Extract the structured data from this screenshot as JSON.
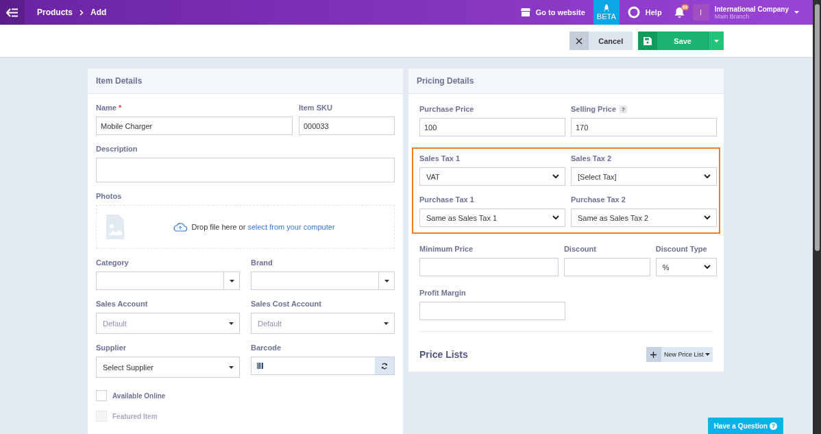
{
  "topbar": {
    "breadcrumb": [
      "Products",
      "Add"
    ],
    "go_to_website": "Go to website",
    "beta": "BETA",
    "help": "Help",
    "notifications": "69",
    "account": {
      "initial": "I",
      "name": "International Company",
      "branch": "Main Branch"
    }
  },
  "actions": {
    "cancel": "Cancel",
    "save": "Save"
  },
  "item_details": {
    "title": "Item Details",
    "rows": [
      [
        {
          "kind": "text",
          "label": "Name",
          "required_mark": "*",
          "value": "Mobile Charger"
        },
        {
          "kind": "text",
          "label": "Item SKU",
          "value": "000033"
        }
      ],
      [
        {
          "kind": "textarea",
          "label": "Description"
        }
      ],
      [
        {
          "kind": "photos",
          "label": "Photos",
          "text": "Drop file here or",
          "link": "select from your computer"
        }
      ],
      [
        {
          "kind": "combo",
          "label": "Category"
        },
        {
          "kind": "combo",
          "label": "Brand"
        }
      ],
      [
        {
          "kind": "select",
          "label": "Sales Account",
          "value": "Default",
          "muted": true
        },
        {
          "kind": "select",
          "label": "Sales Cost Account",
          "value": "Default",
          "muted": true
        }
      ],
      [
        {
          "kind": "select",
          "label": "Supplier",
          "value": "Select Supplier",
          "muted": false
        },
        {
          "kind": "barcode",
          "label": "Barcode"
        }
      ]
    ],
    "checkboxes": [
      {
        "label": "Available Online",
        "checked": false,
        "disabled": false
      },
      {
        "label": "Featured Item",
        "checked": false,
        "disabled": true
      }
    ]
  },
  "pricing_details": {
    "title": "Pricing Details",
    "rows": [
      {
        "fields": [
          {
            "kind": "text",
            "label": "Purchase Price",
            "value": "100"
          },
          {
            "kind": "text",
            "label": "Selling Price",
            "value": "170",
            "help_icon": "?"
          }
        ]
      },
      {
        "highlighted": true,
        "fields": [
          {
            "kind": "dropdown",
            "label": "Sales Tax 1",
            "value": "VAT"
          },
          {
            "kind": "dropdown",
            "label": "Sales Tax 2",
            "value": "[Select Tax]"
          },
          {
            "kind": "dropdown",
            "label": "Purchase Tax 1",
            "value": "Same as Sales Tax 1"
          },
          {
            "kind": "dropdown",
            "label": "Purchase Tax 2",
            "value": "Same as Sales Tax 2"
          }
        ]
      },
      {
        "fields": [
          {
            "kind": "text",
            "label": "Minimum Price"
          },
          {
            "kind": "text",
            "label": "Discount"
          },
          {
            "kind": "dropdown",
            "label": "Discount Type",
            "value": "%"
          }
        ]
      },
      {
        "fields": [
          {
            "kind": "text",
            "label": "Profit Margin"
          }
        ]
      }
    ],
    "price_lists": {
      "title": "Price Lists",
      "button": "New Price List"
    }
  },
  "help_button": {
    "label": "Have a Question",
    "icon": "?"
  }
}
